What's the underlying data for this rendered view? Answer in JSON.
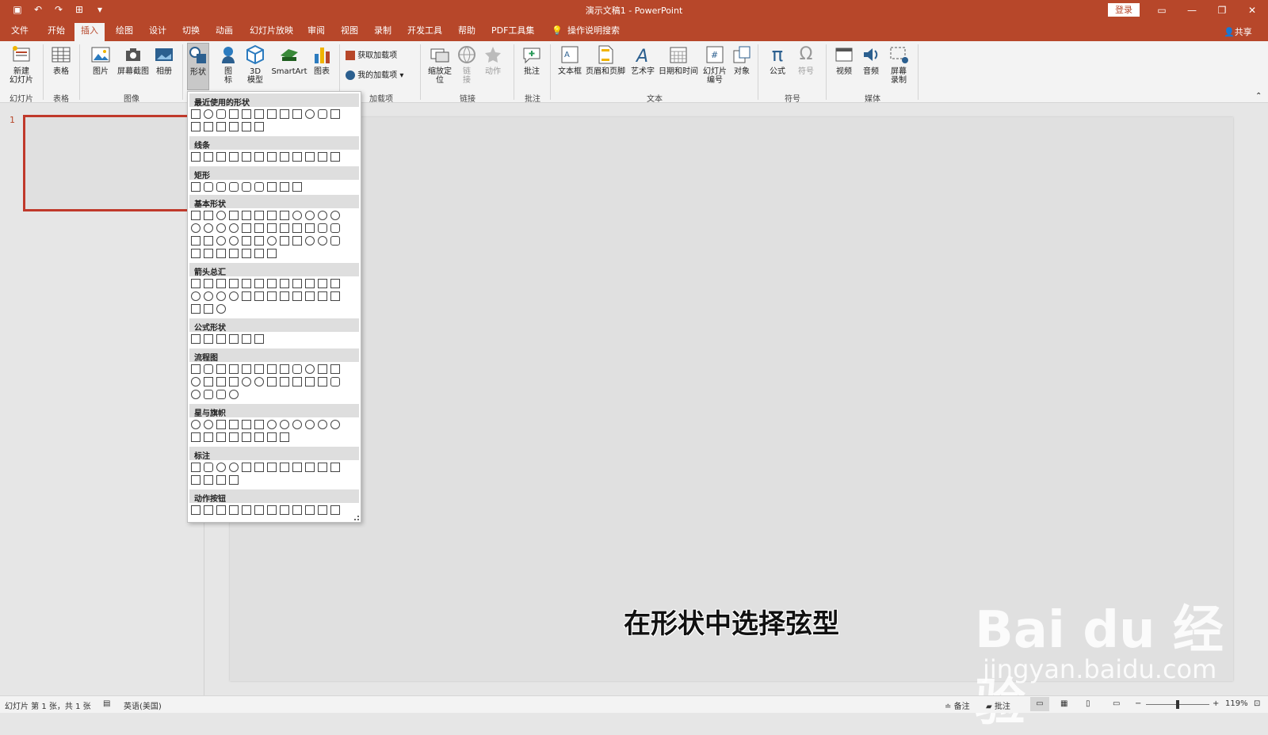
{
  "window": {
    "title": "演示文稿1 - PowerPoint",
    "login_label": "登录",
    "share_label": "共享"
  },
  "tabs": [
    "文件",
    "开始",
    "插入",
    "绘图",
    "设计",
    "切换",
    "动画",
    "幻灯片放映",
    "审阅",
    "视图",
    "录制",
    "开发工具",
    "帮助",
    "PDF工具集",
    "操作说明搜索"
  ],
  "active_tab": "插入",
  "ribbon": {
    "new_slide": "新建\n幻灯片",
    "table": "表格",
    "picture": "图片",
    "screenshot": "屏幕截图",
    "album": "相册",
    "shapes": "形状",
    "icons": "图\n标",
    "model3d": "3D\n模型",
    "smartart": "SmartArt",
    "chart": "图表",
    "get_addins": "获取加载项",
    "my_addins": "我的加载项",
    "zoom": "缩放定\n位",
    "link": "链\n接",
    "action": "动作",
    "comment": "批注",
    "textbox": "文本框",
    "header_footer": "页眉和页脚",
    "wordart": "艺术字",
    "datetime": "日期和时间",
    "slide_number": "幻灯片\n编号",
    "object": "对象",
    "equation": "公式",
    "symbol": "符号",
    "video": "视频",
    "audio": "音频",
    "screen_record": "屏幕\n录制",
    "groups": [
      "幻灯片",
      "表格",
      "图像",
      "加载项",
      "链接",
      "批注",
      "文本",
      "符号",
      "媒体"
    ]
  },
  "shape_menu": {
    "sections": [
      "最近使用的形状",
      "线条",
      "矩形",
      "基本形状",
      "箭头总汇",
      "公式形状",
      "流程图",
      "星与旗帜",
      "标注",
      "动作按钮"
    ]
  },
  "thumbnail_number": "1",
  "slide_caption": "在形状中选择弦型",
  "watermark": {
    "line1": "Bai  du 经验",
    "line2": "jingyan.baidu.com"
  },
  "status": {
    "slide_info": "幻灯片 第 1 张，共 1 张",
    "language": "英语(美国)",
    "notes": "备注",
    "comments": "批注",
    "zoom": "119%"
  },
  "colors": {
    "brand": "#b7472a"
  }
}
